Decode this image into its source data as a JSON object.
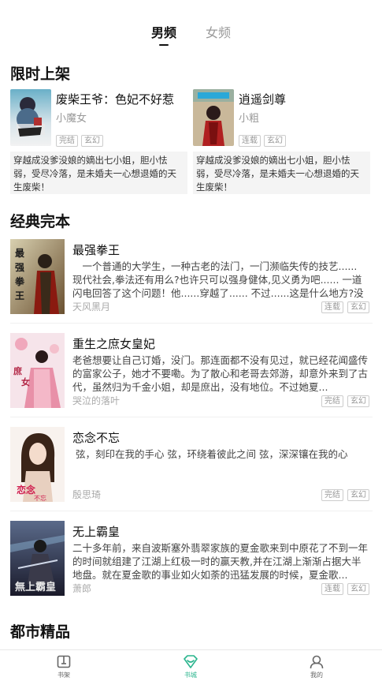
{
  "tabs": [
    {
      "label": "男频",
      "active": true
    },
    {
      "label": "女频",
      "active": false
    }
  ],
  "sections": {
    "limited": "限时上架",
    "classic": "经典完本",
    "urban": "都市精品"
  },
  "limited_books": [
    {
      "title": "废柴王爷：色妃不好惹",
      "author": "小魔女",
      "tags": [
        "完结",
        "玄幻"
      ],
      "desc": "穿越成没爹没娘的嫡出七小姐，胆小怯弱，受尽冷落，是未婚夫一心想退婚的天生废柴！"
    },
    {
      "title": "逍遥剑尊",
      "author": "小粗",
      "tags": [
        "连载",
        "玄幻"
      ],
      "desc": "穿越成没爹没娘的嫡出七小姐，胆小怯弱，受尽冷落，是未婚夫一心想退婚的天生废柴！"
    }
  ],
  "classic_books": [
    {
      "title": "最强拳王",
      "desc": "　一个普通的大学生，一种古老的法门，一门濒临失传的技艺...... 现代社会,拳法还有用么?也许只可以强身健体,见义勇为吧...... 一道闪电回答了这个问题！他......穿越了...... 不过......这是什么地方?没有干...",
      "author": "天风黑月",
      "tags": [
        "连载",
        "玄幻"
      ]
    },
    {
      "title": "重生之庶女皇妃",
      "desc": "老爸想要让自己订婚，没门。那连面都不没有见过，就已经花闻盛传的富家公子，她才不要嘞。为了散心和老哥去郊游，却意外来到了古代，虽然归为千金小姐，却是庶出，没有地位。不过她夏...",
      "author": "哭泣的落叶",
      "tags": [
        "完结",
        "玄幻"
      ]
    },
    {
      "title": "恋念不忘",
      "desc": "弦，刻印在我的手心 弦，环绕着彼此之间 弦，深深镶在我的心",
      "author": "殷思琦",
      "tags": [
        "完结",
        "玄幻"
      ]
    },
    {
      "title": "无上霸皇",
      "desc": "二十多年前，来自波斯塞外翡翠家族的夏金歌来到中原花了不到一年的时间就组建了江湖上红极一时的赢天教,并在江湖上渐渐占据大半地盘。就在夏金歌的事业如火如荼的迅猛发展的时候，夏金歌...",
      "author": "萧郎",
      "tags": [
        "连载",
        "玄幻"
      ]
    }
  ],
  "bottom_nav": [
    {
      "label": "书架",
      "icon": "bookshelf-icon",
      "active": false
    },
    {
      "label": "书城",
      "icon": "bookstore-icon",
      "active": true
    },
    {
      "label": "我的",
      "icon": "profile-icon",
      "active": false
    }
  ],
  "colors": {
    "accent": "#2bb58e"
  }
}
